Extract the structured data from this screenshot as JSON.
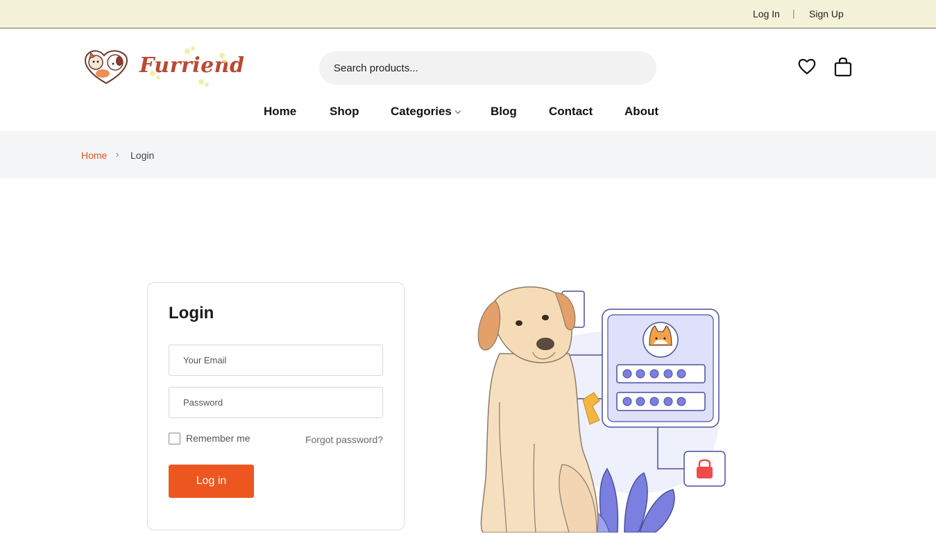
{
  "topbar": {
    "login": "Log In",
    "separator": "|",
    "signup": "Sign Up"
  },
  "brand": {
    "name": "Furriend",
    "icon": "cat-dog-heart-logo"
  },
  "search": {
    "placeholder": "Search products...",
    "value": ""
  },
  "header_icons": {
    "wishlist": "heart-icon",
    "cart": "shopping-bag-icon"
  },
  "nav": {
    "items": [
      {
        "label": "Home"
      },
      {
        "label": "Shop"
      },
      {
        "label": "Categories",
        "has_dropdown": true
      },
      {
        "label": "Blog"
      },
      {
        "label": "Contact"
      },
      {
        "label": "About"
      }
    ]
  },
  "breadcrumb": {
    "home": "Home",
    "separator": "›",
    "current": "Login"
  },
  "login_form": {
    "title": "Login",
    "email_placeholder": "Your Email",
    "password_placeholder": "Password",
    "remember_label": "Remember me",
    "remember_checked": false,
    "forgot_label": "Forgot password?",
    "submit_label": "Log in"
  },
  "colors": {
    "accent": "#ee5620",
    "topbar_bg": "#f4f2d8",
    "brand_text": "#b84a32",
    "breadcrumb_bg": "#f4f5f7",
    "illustration_purple": "#7b7fe0"
  },
  "illustration": {
    "description_icon": "dog-with-login-panel-illustration"
  }
}
